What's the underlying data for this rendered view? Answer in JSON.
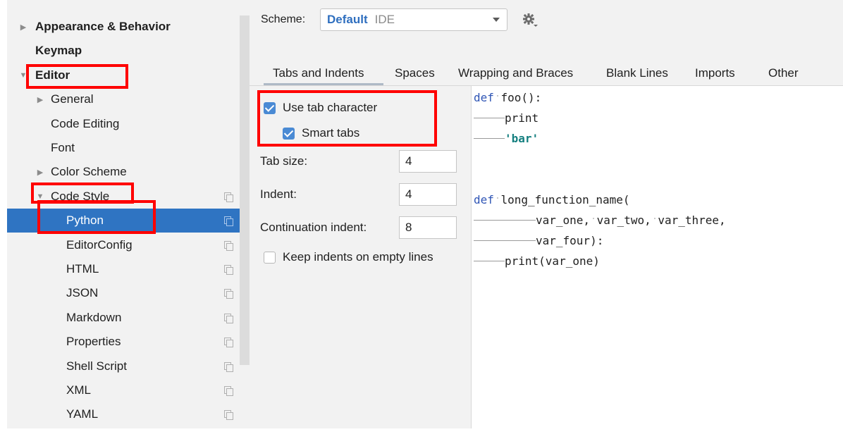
{
  "tree": {
    "items": [
      {
        "label": "Appearance & Behavior",
        "bold": true,
        "arrow": "right",
        "indent": 0
      },
      {
        "label": "Keymap",
        "bold": true,
        "arrow": "none",
        "indent": 0
      },
      {
        "label": "Editor",
        "bold": true,
        "arrow": "down",
        "indent": 0
      },
      {
        "label": "General",
        "arrow": "right",
        "indent": 1
      },
      {
        "label": "Code Editing",
        "arrow": "none",
        "indent": 1
      },
      {
        "label": "Font",
        "arrow": "none",
        "indent": 1
      },
      {
        "label": "Color Scheme",
        "arrow": "right",
        "indent": 1
      },
      {
        "label": "Code Style",
        "arrow": "down",
        "indent": 1,
        "copy": true
      },
      {
        "label": "Python",
        "indent": 2,
        "selected": true,
        "copy": true
      },
      {
        "label": "EditorConfig",
        "indent": 2,
        "copy": true
      },
      {
        "label": "HTML",
        "indent": 2,
        "copy": true
      },
      {
        "label": "JSON",
        "indent": 2,
        "copy": true
      },
      {
        "label": "Markdown",
        "indent": 2,
        "copy": true
      },
      {
        "label": "Properties",
        "indent": 2,
        "copy": true
      },
      {
        "label": "Shell Script",
        "indent": 2,
        "copy": true
      },
      {
        "label": "XML",
        "indent": 2,
        "copy": true
      },
      {
        "label": "YAML",
        "indent": 2,
        "copy": true
      }
    ]
  },
  "scheme": {
    "label": "Scheme:",
    "name": "Default",
    "type": "IDE"
  },
  "tabs": [
    {
      "label": "Tabs and Indents",
      "active": true
    },
    {
      "label": "Spaces"
    },
    {
      "label": "Wrapping and Braces"
    },
    {
      "label": "Blank Lines"
    },
    {
      "label": "Imports"
    },
    {
      "label": "Other"
    }
  ],
  "options": {
    "use_tab_character": {
      "label": "Use tab character",
      "checked": true
    },
    "smart_tabs": {
      "label": "Smart tabs",
      "checked": true
    },
    "tab_size": {
      "label": "Tab size:",
      "value": "4"
    },
    "indent": {
      "label": "Indent:",
      "value": "4"
    },
    "continuation_indent": {
      "label": "Continuation indent:",
      "value": "8"
    },
    "keep_indents": {
      "label": "Keep indents on empty lines",
      "checked": false
    }
  },
  "preview": {
    "lines": [
      [
        {
          "t": "kw",
          "v": "def"
        },
        {
          "t": "spc"
        },
        {
          "t": "plain",
          "v": "foo():"
        }
      ],
      [
        {
          "t": "tab"
        },
        {
          "t": "plain",
          "v": "print"
        }
      ],
      [
        {
          "t": "tab"
        },
        {
          "t": "str",
          "v": "'bar'"
        }
      ],
      [],
      [],
      [
        {
          "t": "kw",
          "v": "def"
        },
        {
          "t": "spc"
        },
        {
          "t": "plain",
          "v": "long_function_name("
        }
      ],
      [
        {
          "t": "tab"
        },
        {
          "t": "tab"
        },
        {
          "t": "plain",
          "v": "var_one,"
        },
        {
          "t": "spc"
        },
        {
          "t": "plain",
          "v": "var_two,"
        },
        {
          "t": "spc"
        },
        {
          "t": "plain",
          "v": "var_three,"
        }
      ],
      [
        {
          "t": "tab"
        },
        {
          "t": "tab"
        },
        {
          "t": "plain",
          "v": "var_four):"
        }
      ],
      [
        {
          "t": "tab"
        },
        {
          "t": "plain",
          "v": "print(var_one)"
        }
      ]
    ]
  },
  "colors": {
    "selection": "#2f74c2",
    "annotation": "#ff0000",
    "checkbox": "#4a8ad4",
    "keyword": "#2f55b5",
    "string": "#168080"
  }
}
